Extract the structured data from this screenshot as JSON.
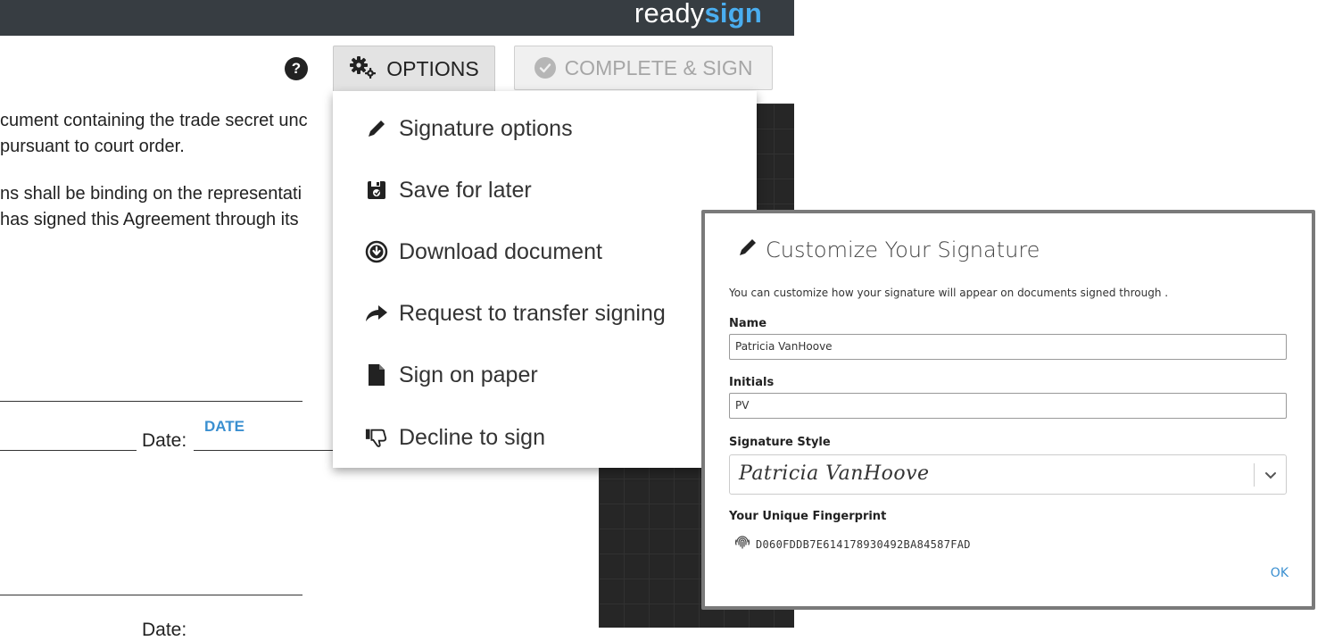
{
  "header": {
    "logo_light": "ready",
    "logo_bold": "sign",
    "accent_color": "#4aaef0"
  },
  "toolbar": {
    "help_icon": "question-circle-icon",
    "help_symbol": "?",
    "options_label": "OPTIONS",
    "complete_label": "COMPLETE & SIGN"
  },
  "document": {
    "lines": [
      "cument containing the trade secret unc",
      "pursuant to court order.",
      "ns shall be binding on the representati",
      "has signed this Agreement through its"
    ],
    "date_label": "Date:",
    "date_field": "DATE",
    "date_label_2": "Date:"
  },
  "options_menu": {
    "items": [
      {
        "label": "Signature options",
        "icon": "pen-icon"
      },
      {
        "label": "Save for later",
        "icon": "save-icon"
      },
      {
        "label": "Download document",
        "icon": "download-circle-icon"
      },
      {
        "label": "Request to transfer signing",
        "icon": "share-arrow-icon"
      },
      {
        "label": "Sign on paper",
        "icon": "file-icon"
      },
      {
        "label": "Decline to sign",
        "icon": "thumbs-down-icon"
      }
    ]
  },
  "signature_modal": {
    "title": "Customize Your Signature",
    "description": "You can customize how your signature will appear on documents signed through .",
    "name_label": "Name",
    "name_value": "Patricia VanHoove",
    "initials_label": "Initials",
    "initials_value": "PV",
    "style_label": "Signature Style",
    "style_value": "Patricia VanHoove",
    "fingerprint_label": "Your Unique Fingerprint",
    "fingerprint_value": "D060FDDB7E614178930492BA84587FAD",
    "ok_label": "OK"
  }
}
